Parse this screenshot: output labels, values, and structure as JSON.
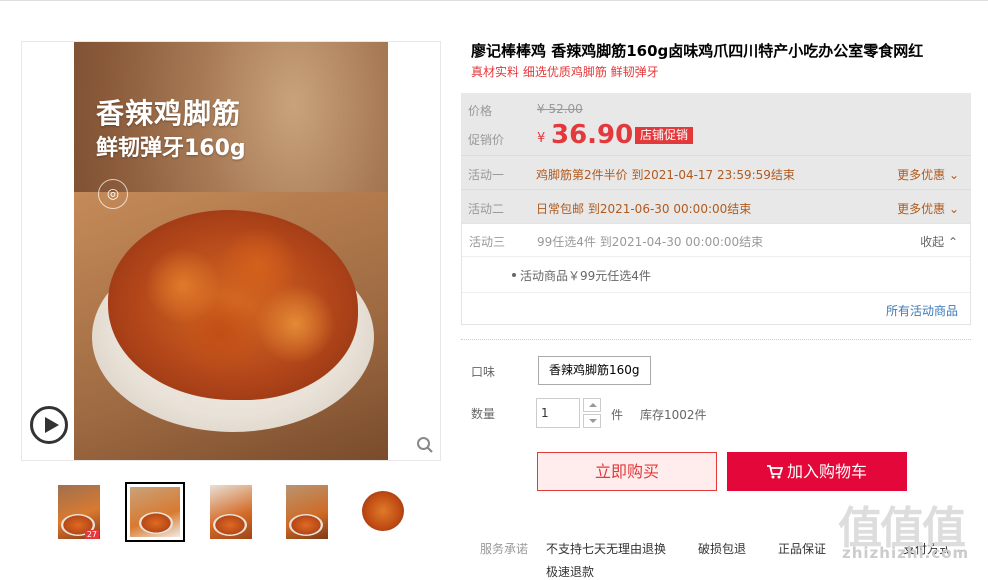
{
  "product": {
    "title": "廖记棒棒鸡 香辣鸡脚筋160g卤味鸡爪四川特产小吃办公室零食网红",
    "subtitle": "真材实料 细选优质鸡脚筋 鲜韧弹牙"
  },
  "gallery": {
    "main_overlay_line1": "香辣鸡脚筋",
    "main_overlay_line2": "鲜韧弹牙160g",
    "thumbs": [
      "thumb-1",
      "thumb-2",
      "thumb-3",
      "thumb-4",
      "thumb-5"
    ],
    "thumb1_caption": "27"
  },
  "price": {
    "orig_label": "价格",
    "orig_value": "¥ 52.00",
    "promo_label": "促销价",
    "currency": "¥",
    "promo_value": "36.90",
    "promo_tag": "店铺促销"
  },
  "activities": [
    {
      "label": "活动一",
      "text": "鸡脚筋第2件半价  到2021-04-17 23:59:59结束",
      "more": "更多优惠"
    },
    {
      "label": "活动二",
      "text": "日常包邮  到2021-06-30 00:00:00结束",
      "more": "更多优惠"
    },
    {
      "label": "活动三",
      "text": "99任选4件  到2021-04-30 00:00:00结束",
      "fold": "收起"
    }
  ],
  "activity_detail": {
    "item": "活动商品￥99元任选4件",
    "all_link": "所有活动商品"
  },
  "options": {
    "flavor_label": "口味",
    "flavor_value": "香辣鸡脚筋160g",
    "qty_label": "数量",
    "qty_value": "1",
    "qty_unit": "件",
    "stock": "库存1002件"
  },
  "actions": {
    "buy": "立即购买",
    "cart": "加入购物车"
  },
  "service": {
    "label": "服务承诺",
    "items": [
      "不支持七天无理由退换",
      "破损包退",
      "正品保证",
      "极速退款"
    ],
    "payment": "支付方式"
  },
  "watermark": {
    "big": "值值值",
    "small": "zhizhizhi.com"
  },
  "colors": {
    "accent": "#e4393c",
    "cart": "#e4083a",
    "activity_text": "#b05a1e",
    "link": "#3a7ab6"
  }
}
